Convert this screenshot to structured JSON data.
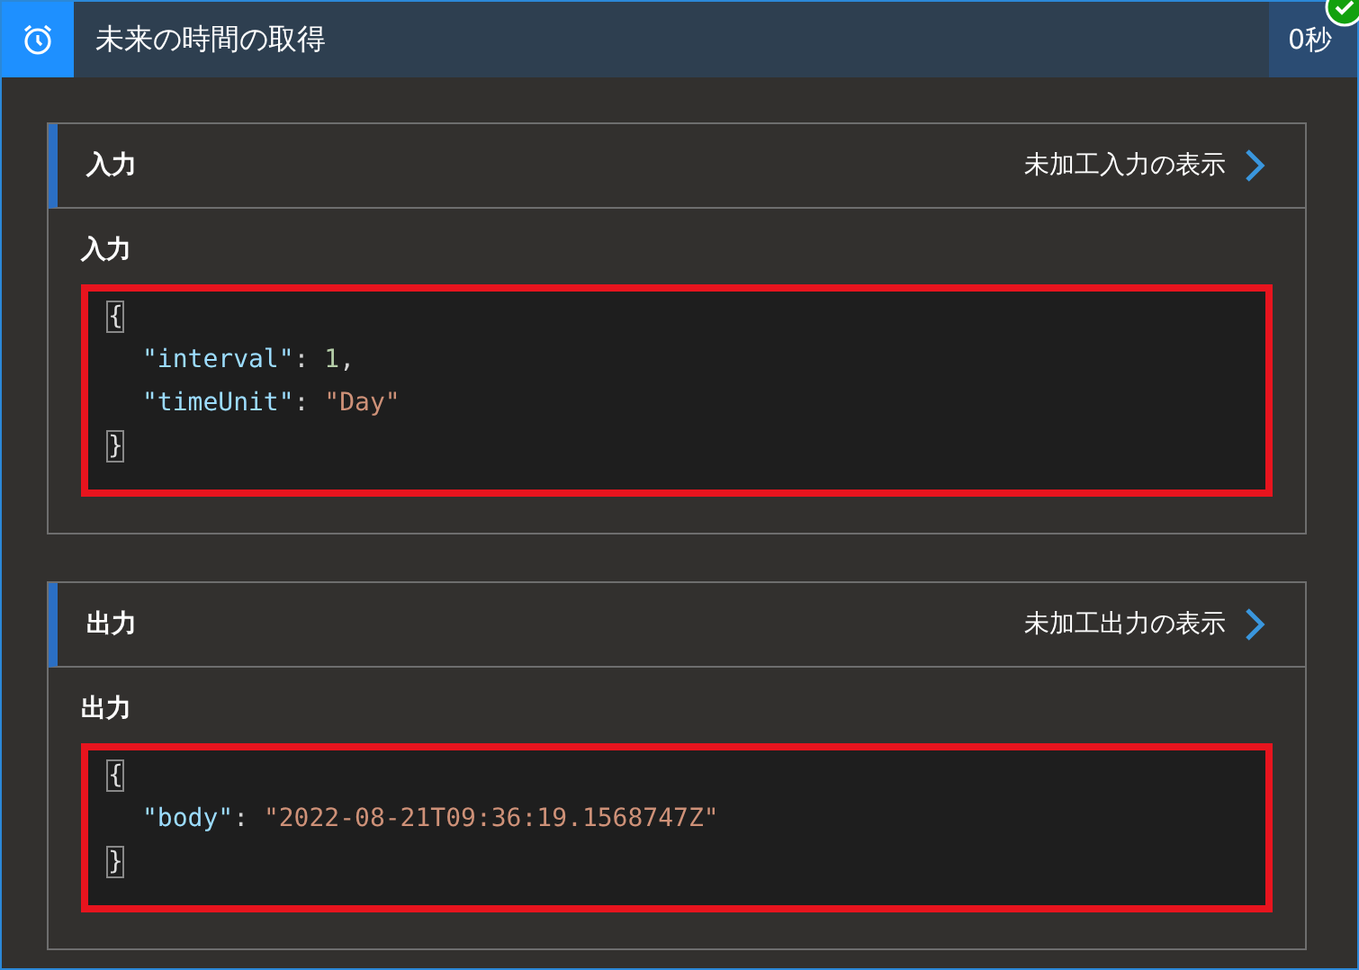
{
  "header": {
    "title": "未来の時間の取得",
    "duration": "0秒",
    "succeeded": true
  },
  "sections": [
    {
      "title": "入力",
      "link": "未加工入力の表示",
      "label": "入力",
      "code": [
        {
          "indent": false,
          "tokens": [
            {
              "kind": "brace",
              "text": "{"
            }
          ]
        },
        {
          "indent": true,
          "tokens": [
            {
              "kind": "key",
              "text": "\"interval\""
            },
            {
              "kind": "punct",
              "text": ": "
            },
            {
              "kind": "number",
              "text": "1"
            },
            {
              "kind": "punct",
              "text": ","
            }
          ]
        },
        {
          "indent": true,
          "tokens": [
            {
              "kind": "key",
              "text": "\"timeUnit\""
            },
            {
              "kind": "punct",
              "text": ": "
            },
            {
              "kind": "string",
              "text": "\"Day\""
            }
          ]
        },
        {
          "indent": false,
          "tokens": [
            {
              "kind": "brace",
              "text": "}"
            }
          ]
        }
      ]
    },
    {
      "title": "出力",
      "link": "未加工出力の表示",
      "label": "出力",
      "code": [
        {
          "indent": false,
          "tokens": [
            {
              "kind": "brace",
              "text": "{"
            }
          ]
        },
        {
          "indent": true,
          "tokens": [
            {
              "kind": "key",
              "text": "\"body\""
            },
            {
              "kind": "punct",
              "text": ": "
            },
            {
              "kind": "string",
              "text": "\"2022-08-21T09:36:19.1568747Z\""
            }
          ]
        },
        {
          "indent": false,
          "tokens": [
            {
              "kind": "brace",
              "text": "}"
            }
          ]
        }
      ]
    }
  ]
}
